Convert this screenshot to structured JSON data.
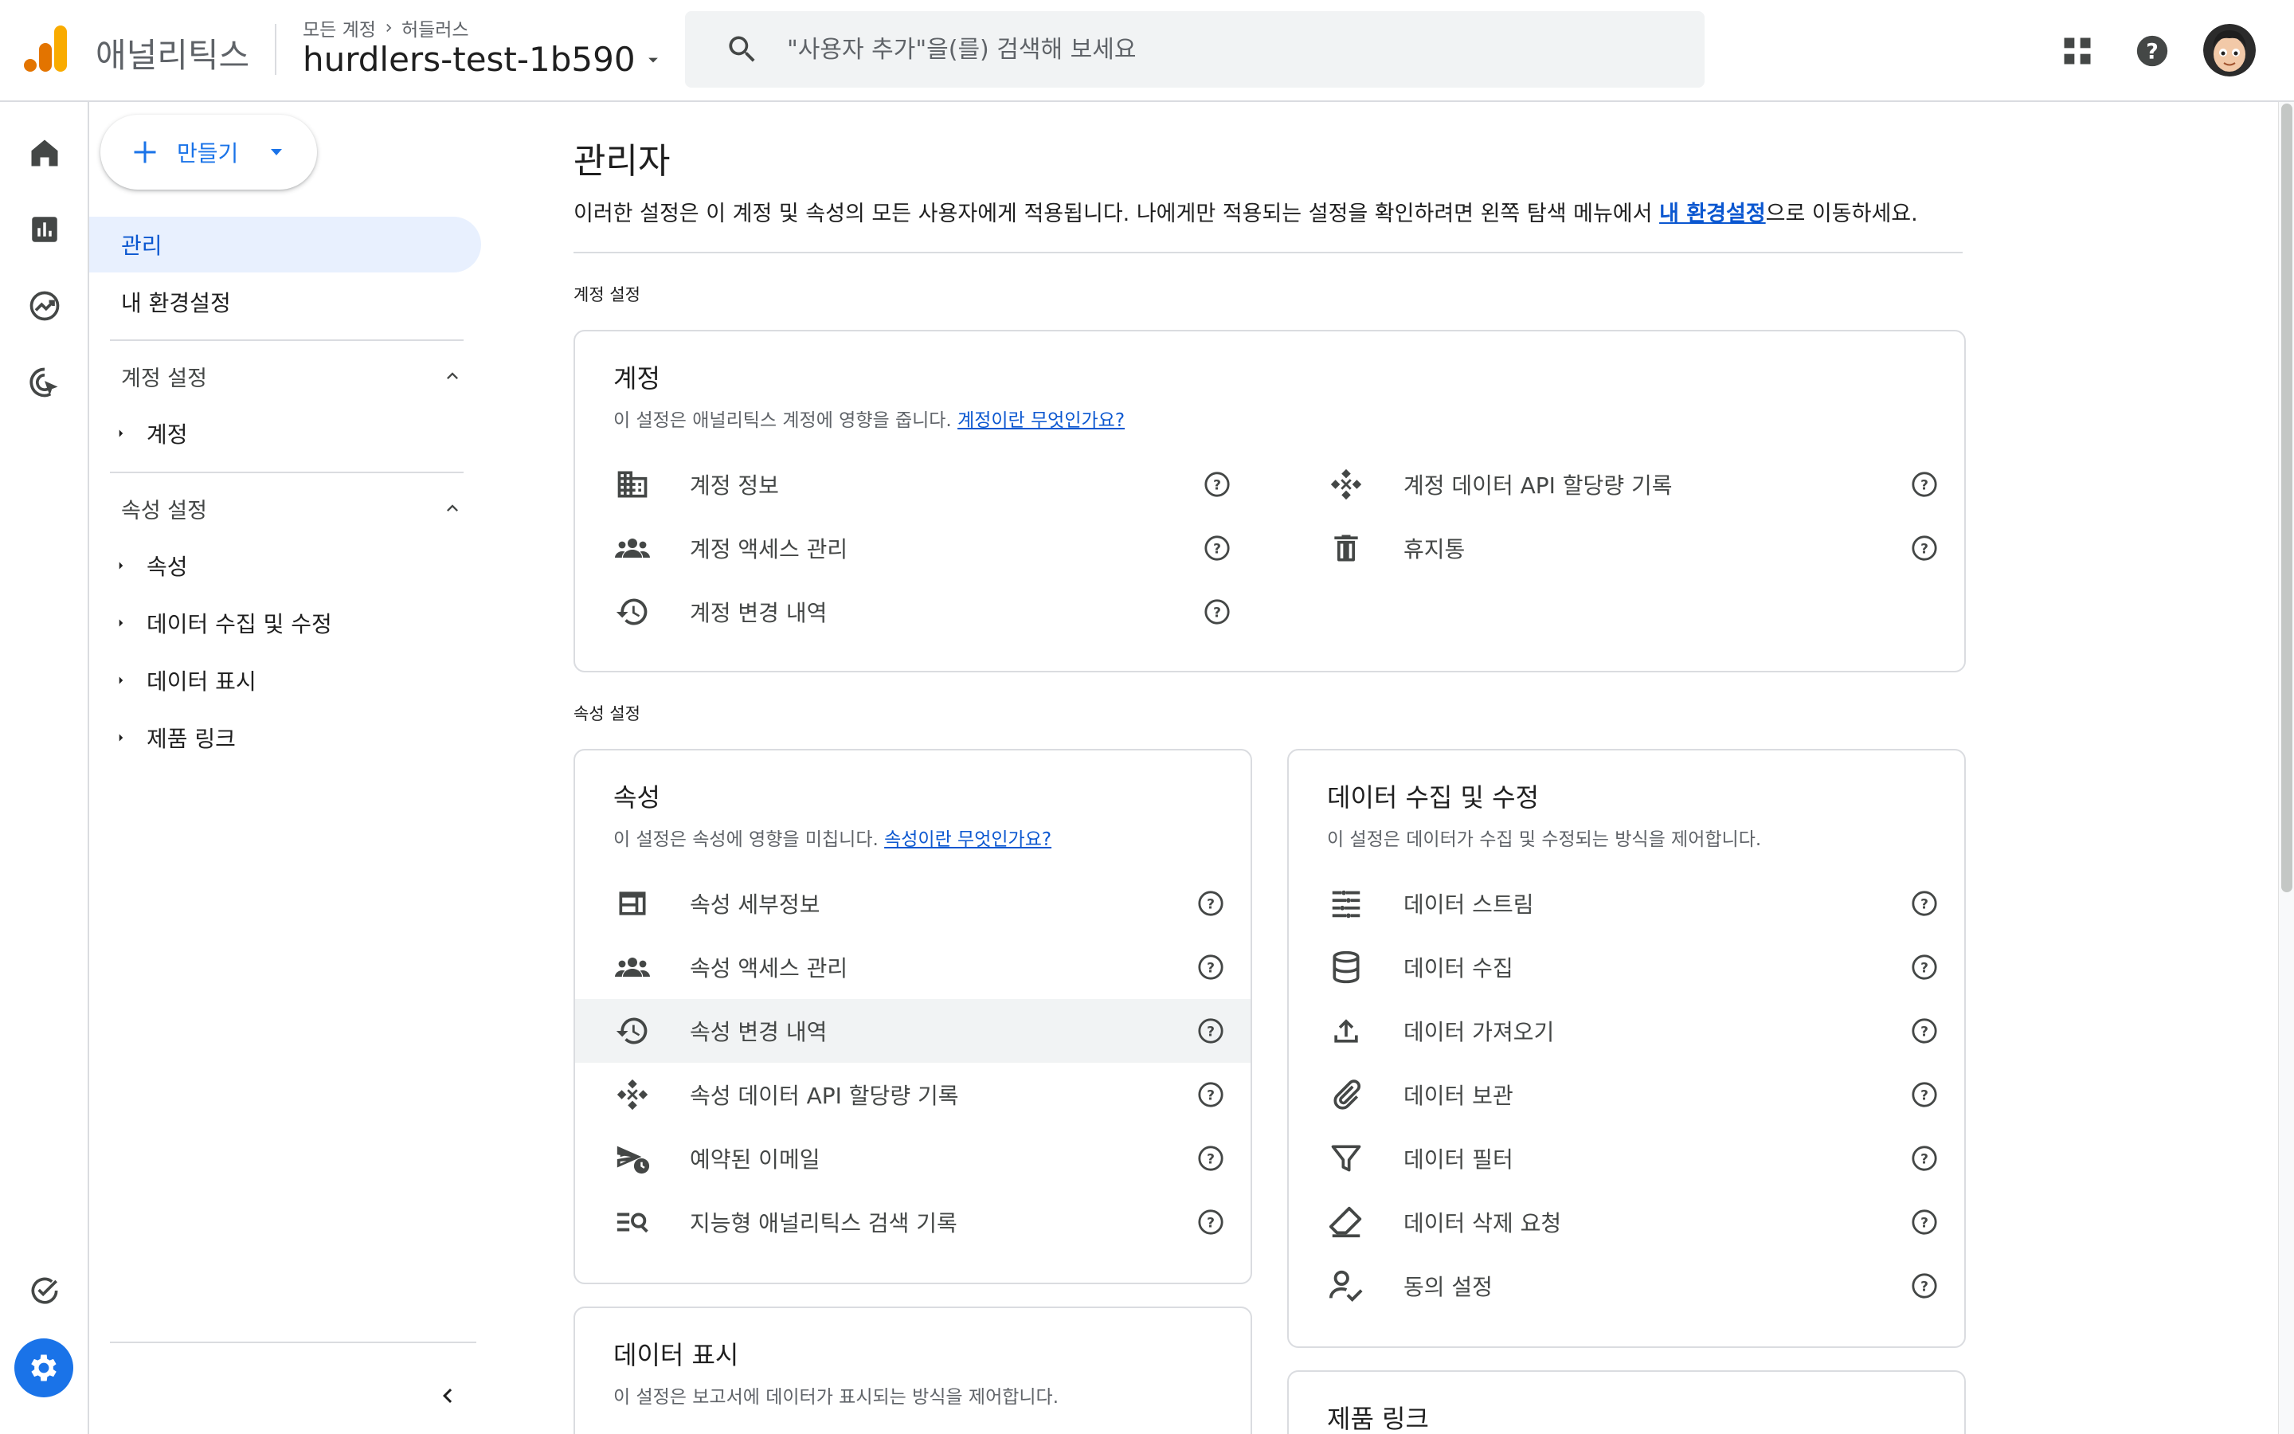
{
  "header": {
    "app_name": "애널리틱스",
    "breadcrumb_root": "모든 계정",
    "breadcrumb_account": "허들러스",
    "property_name": "hurdlers-test-1b590",
    "search_placeholder": "\"사용자 추가\"을(를) 검색해 보세요"
  },
  "sidebar": {
    "create_label": "만들기",
    "admin_label": "관리",
    "my_settings_label": "내 환경설정",
    "account_section": "계정 설정",
    "account_items": [
      "계정"
    ],
    "property_section": "속성 설정",
    "property_items": [
      "속성",
      "데이터 수집 및 수정",
      "데이터 표시",
      "제품 링크"
    ]
  },
  "main": {
    "title": "관리자",
    "desc_before": "이러한 설정은 이 계정 및 속성의 모든 사용자에게 적용됩니다. 나에게만 적용되는 설정을 확인하려면 왼쪽 탐색 메뉴에서 ",
    "desc_link": "내 환경설정",
    "desc_after": "으로 이동하세요.",
    "account_group_label": "계정 설정",
    "property_group_label": "속성 설정",
    "account_card": {
      "title": "계정",
      "desc": "이 설정은 애널리틱스 계정에 영향을 줍니다. ",
      "link": "계정이란 무엇인가요?",
      "left_items": [
        "계정 정보",
        "계정 액세스 관리",
        "계정 변경 내역"
      ],
      "right_items": [
        "계정 데이터 API 할당량 기록",
        "휴지통"
      ]
    },
    "property_card": {
      "title": "속성",
      "desc": "이 설정은 속성에 영향을 미칩니다. ",
      "link": "속성이란 무엇인가요?",
      "items": [
        "속성 세부정보",
        "속성 액세스 관리",
        "속성 변경 내역",
        "속성 데이터 API 할당량 기록",
        "예약된 이메일",
        "지능형 애널리틱스 검색 기록"
      ]
    },
    "data_collection_card": {
      "title": "데이터 수집 및 수정",
      "desc": "이 설정은 데이터가 수집 및 수정되는 방식을 제어합니다.",
      "items": [
        "데이터 스트림",
        "데이터 수집",
        "데이터 가져오기",
        "데이터 보관",
        "데이터 필터",
        "데이터 삭제 요청",
        "동의 설정"
      ]
    },
    "data_display_card": {
      "title": "데이터 표시",
      "desc": "이 설정은 보고서에 데이터가 표시되는 방식을 제어합니다."
    },
    "product_links_card": {
      "title": "제품 링크"
    }
  },
  "colors": {
    "accent": "#1a73e8",
    "link": "#0b57d0",
    "active_bg": "#e8f0fe",
    "logo_orange": "#f9ab00",
    "logo_dark": "#e37400"
  }
}
